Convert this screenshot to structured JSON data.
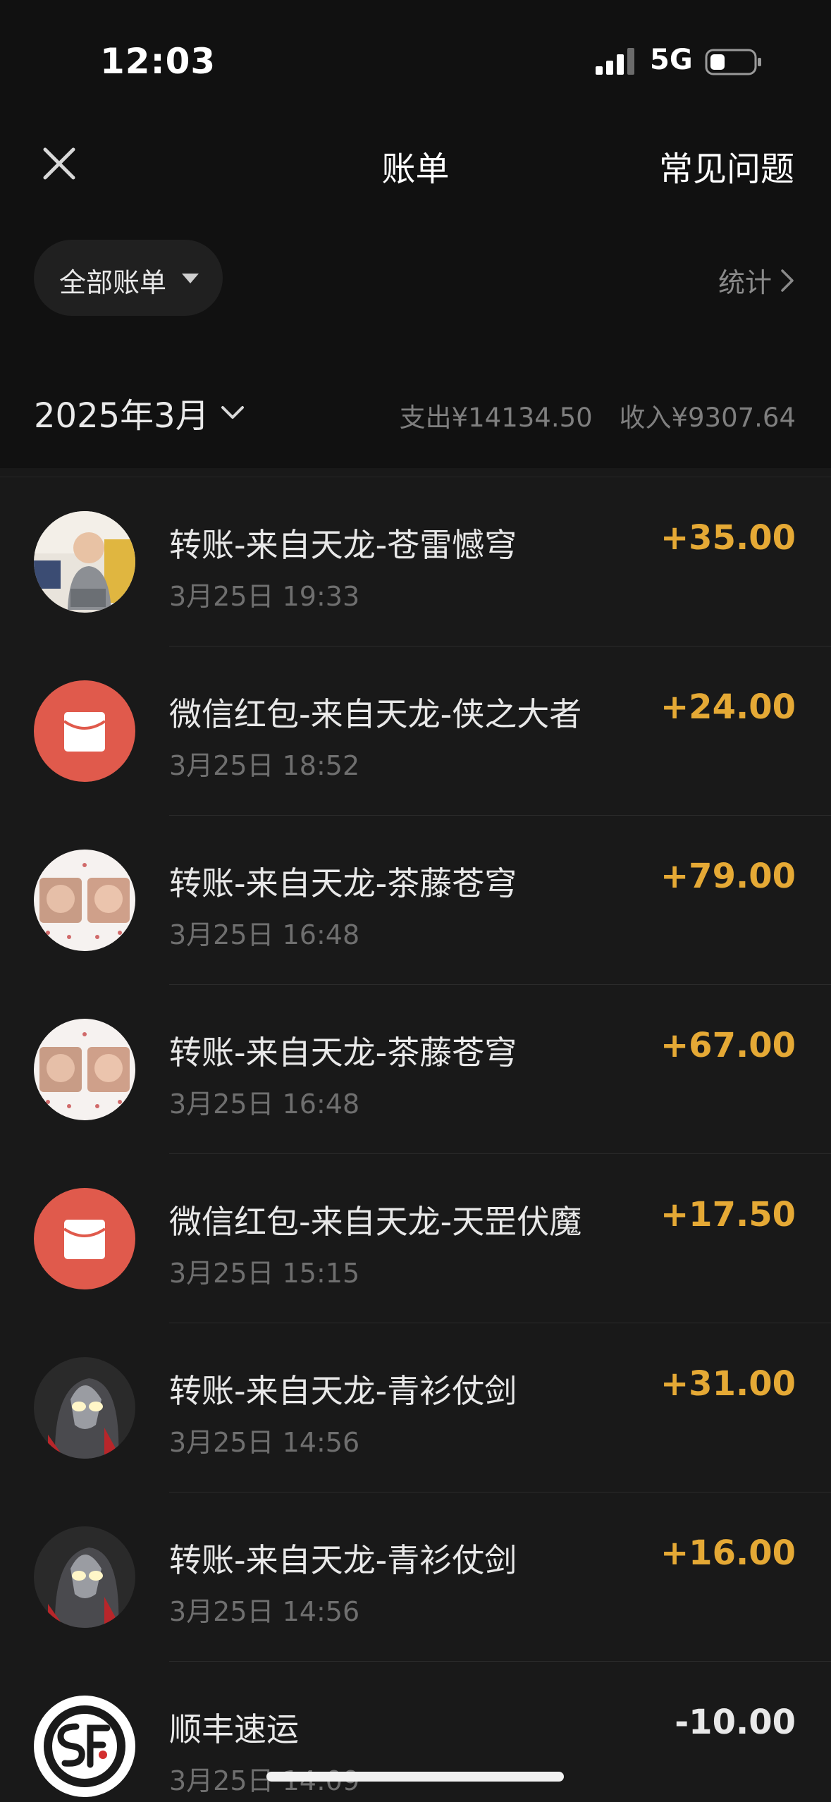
{
  "status_bar": {
    "time": "12:03",
    "network": "5G",
    "signal_icon": "cellular-signal-icon",
    "battery_icon": "battery-low-icon"
  },
  "nav": {
    "close_icon": "close-icon",
    "title": "账单",
    "faq": "常见问题"
  },
  "filter": {
    "label": "全部账单",
    "caret_icon": "caret-down-icon",
    "stats": "统计",
    "stats_icon": "chevron-right-icon"
  },
  "month": {
    "label": "2025年3月",
    "chevron_icon": "chevron-down-icon",
    "expense": "支出¥14134.50",
    "income": "收入¥9307.64"
  },
  "colors": {
    "background": "#191919",
    "header_background": "#111111",
    "income_amount": "#e5a935",
    "red_packet": "#e05a4c"
  },
  "transactions": [
    {
      "title": "转账-来自天龙-苍雷憾穹",
      "time": "3月25日 19:33",
      "amount": "+35.00",
      "type": "income",
      "avatar": "baby-photo-avatar"
    },
    {
      "title": "微信红包-来自天龙-侠之大者",
      "time": "3月25日 18:52",
      "amount": "+24.00",
      "type": "income",
      "avatar": "red-packet-icon"
    },
    {
      "title": "转账-来自天龙-茶藤苍穹",
      "time": "3月25日 16:48",
      "amount": "+79.00",
      "type": "income",
      "avatar": "twin-baby-photo-avatar"
    },
    {
      "title": "转账-来自天龙-茶藤苍穹",
      "time": "3月25日 16:48",
      "amount": "+67.00",
      "type": "income",
      "avatar": "twin-baby-photo-avatar"
    },
    {
      "title": "微信红包-来自天龙-天罡伏魔",
      "time": "3月25日 15:15",
      "amount": "+17.50",
      "type": "income",
      "avatar": "red-packet-icon"
    },
    {
      "title": "转账-来自天龙-青衫仗剑",
      "time": "3月25日 14:56",
      "amount": "+31.00",
      "type": "income",
      "avatar": "ultraman-avatar"
    },
    {
      "title": "转账-来自天龙-青衫仗剑",
      "time": "3月25日 14:56",
      "amount": "+16.00",
      "type": "income",
      "avatar": "ultraman-avatar"
    },
    {
      "title": "顺丰速运",
      "time": "3月25日 14:09",
      "amount": "-10.00",
      "type": "expense",
      "avatar": "sf-express-logo"
    }
  ]
}
